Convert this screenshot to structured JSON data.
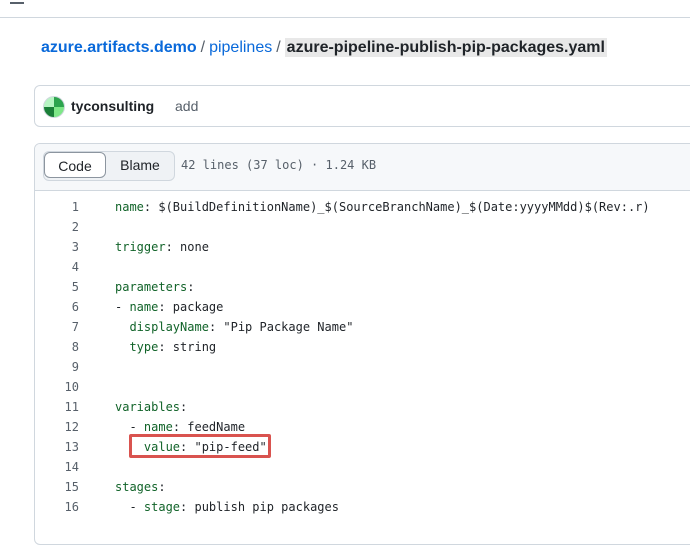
{
  "breadcrumb": {
    "repo": "azure.artifacts.demo",
    "sep1": "/",
    "dir": "pipelines",
    "sep2": "/",
    "file": "azure-pipeline-publish-pip-packages.yaml"
  },
  "commit": {
    "author": "tyconsulting",
    "message": "add"
  },
  "file_header": {
    "code_tab": "Code",
    "blame_tab": "Blame",
    "info": "42 lines (37 loc) · 1.24 KB"
  },
  "code_lines": [
    {
      "n": "1",
      "key": "name",
      "rest": ": $(BuildDefinitionName)_$(SourceBranchName)_$(Date:yyyyMMdd)$(Rev:.r)"
    },
    {
      "n": "2",
      "key": "",
      "rest": ""
    },
    {
      "n": "3",
      "key": "trigger",
      "rest": ": none"
    },
    {
      "n": "4",
      "key": "",
      "rest": ""
    },
    {
      "n": "5",
      "key": "parameters",
      "rest": ":"
    },
    {
      "n": "6",
      "key": "- name",
      "rest": ": package"
    },
    {
      "n": "7",
      "key": "  displayName",
      "rest": ": \"Pip Package Name\""
    },
    {
      "n": "8",
      "key": "  type",
      "rest": ": string"
    },
    {
      "n": "9",
      "key": "",
      "rest": ""
    },
    {
      "n": "10",
      "key": "",
      "rest": ""
    },
    {
      "n": "11",
      "key": "variables",
      "rest": ":"
    },
    {
      "n": "12",
      "key": "  - name",
      "rest": ": feedName"
    },
    {
      "n": "13",
      "key": "    value",
      "rest": ": \"pip-feed\""
    },
    {
      "n": "14",
      "key": "",
      "rest": ""
    },
    {
      "n": "15",
      "key": "stages",
      "rest": ":"
    },
    {
      "n": "16",
      "key": "  - stage",
      "rest": ": publish pip packages"
    }
  ]
}
